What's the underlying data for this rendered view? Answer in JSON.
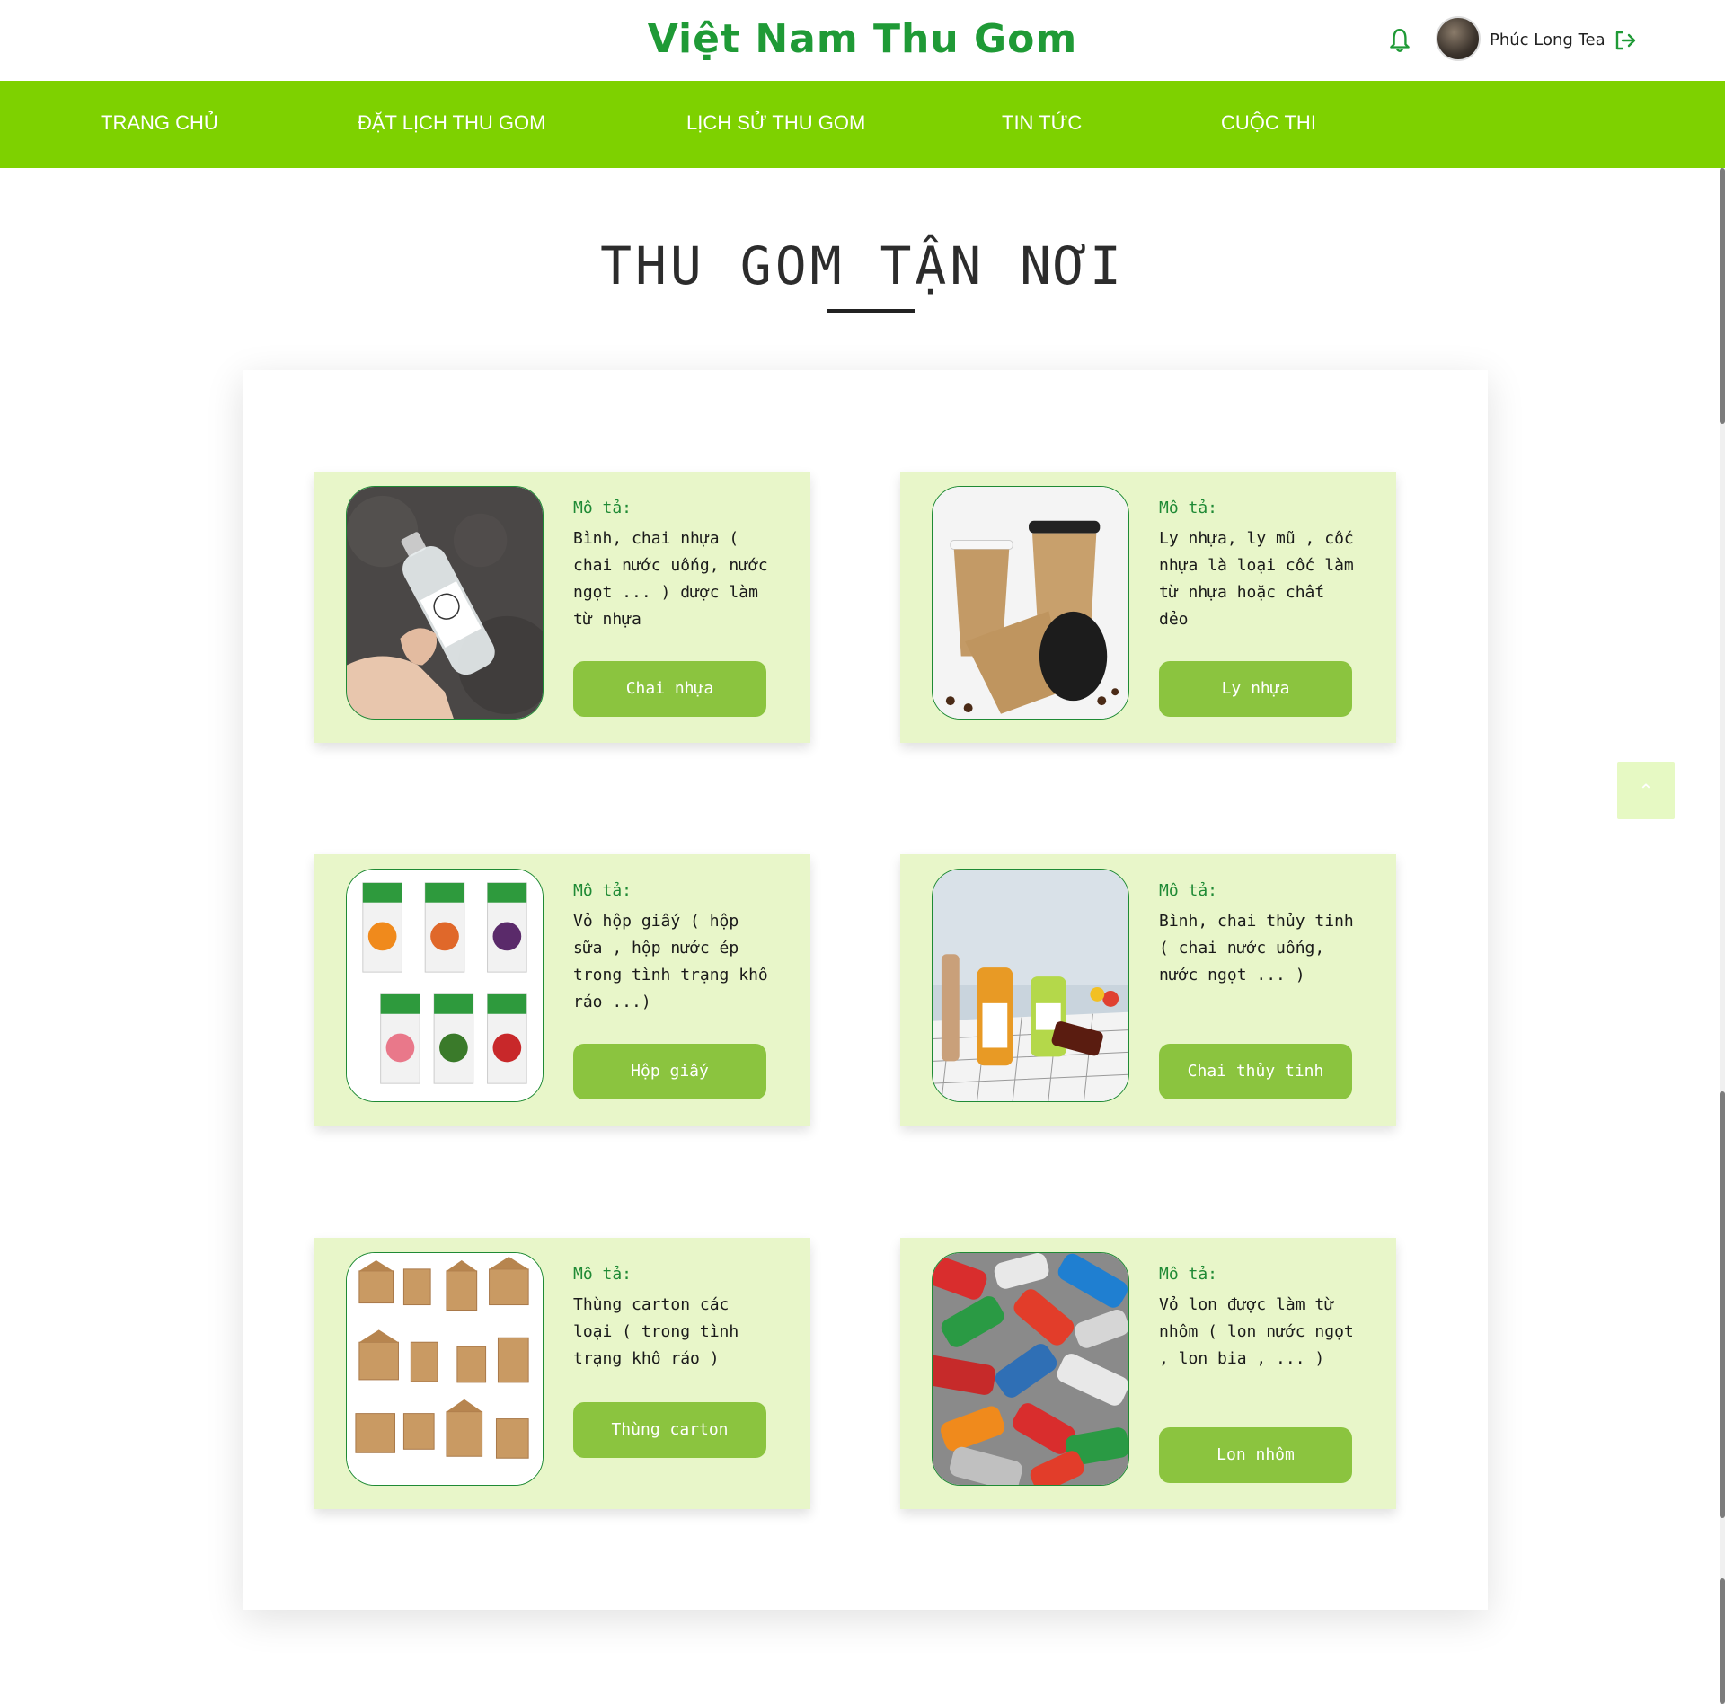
{
  "header": {
    "brand": "Việt Nam Thu Gom",
    "username": "Phúc Long Tea"
  },
  "nav": {
    "items": [
      "TRANG CHỦ",
      "ĐẶT LỊCH THU GOM",
      "LỊCH SỬ THU GOM",
      "TIN TỨC",
      "CUỘC THI"
    ]
  },
  "section": {
    "title": "THU GOM TẬN NƠI"
  },
  "cards": [
    {
      "label": "Mô tả:",
      "text": "Bình, chai nhựa ( chai nước uống, nước ngọt ... ) được làm từ nhựa",
      "button": "Chai nhựa",
      "image": "plastic-bottle"
    },
    {
      "label": "Mô tả:",
      "text": "Ly nhựa, ly mũ , cốc nhựa là loại cốc làm từ nhựa hoặc chất dẻo",
      "button": "Ly nhựa",
      "image": "plastic-cups"
    },
    {
      "label": "Mô tả:",
      "text": "Vỏ hộp giấy ( hộp sữa , hộp nước ép trong tình trạng khô ráo ...)",
      "button": "Hộp giấy",
      "image": "juice-cartons"
    },
    {
      "label": "Mô tả:",
      "text": "Bình, chai thủy tinh ( chai nước uống, nước ngọt ... )",
      "button": "Chai thủy tinh",
      "image": "glass-bottles"
    },
    {
      "label": "Mô tả:",
      "text": "Thùng carton các loại ( trong tình trạng khô ráo )",
      "button": "Thùng carton",
      "image": "carton-boxes"
    },
    {
      "label": "Mô tả:",
      "text": "Vỏ lon được làm từ nhôm ( lon nước ngọt , lon bia , ... )",
      "button": "Lon nhôm",
      "image": "aluminum-cans"
    }
  ],
  "colors": {
    "brand": "#1f9a36",
    "nav_bg": "#7ed100",
    "card_bg": "#e8f6c9",
    "button_bg": "#8bc43f"
  }
}
